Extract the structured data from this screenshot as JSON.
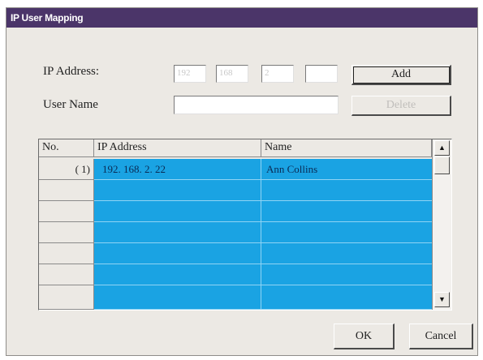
{
  "window": {
    "title": "IP User Mapping"
  },
  "form": {
    "ip_address_label": "IP Address:",
    "ip_octets": [
      "192",
      "168",
      "2",
      ""
    ],
    "user_name_label": "User Name",
    "user_name_value": "",
    "add_label": "Add",
    "delete_label": "Delete"
  },
  "table": {
    "columns": [
      "No.",
      "IP Address",
      "Name"
    ],
    "rows": [
      {
        "no": "( 1)",
        "ip": "192. 168.  2. 22",
        "name": "Ann Collins"
      },
      {
        "no": "",
        "ip": "",
        "name": ""
      },
      {
        "no": "",
        "ip": "",
        "name": ""
      },
      {
        "no": "",
        "ip": "",
        "name": ""
      },
      {
        "no": "",
        "ip": "",
        "name": ""
      },
      {
        "no": "",
        "ip": "",
        "name": ""
      },
      {
        "no": "",
        "ip": "",
        "name": ""
      }
    ],
    "scroll_up_icon": "triangle-up",
    "scroll_down_icon": "triangle-down"
  },
  "footer": {
    "ok_label": "OK",
    "cancel_label": "Cancel"
  },
  "colors": {
    "title_bar": "#4b3569",
    "selection": "#1aa3e3",
    "dialog_bg": "#ece9e4"
  }
}
